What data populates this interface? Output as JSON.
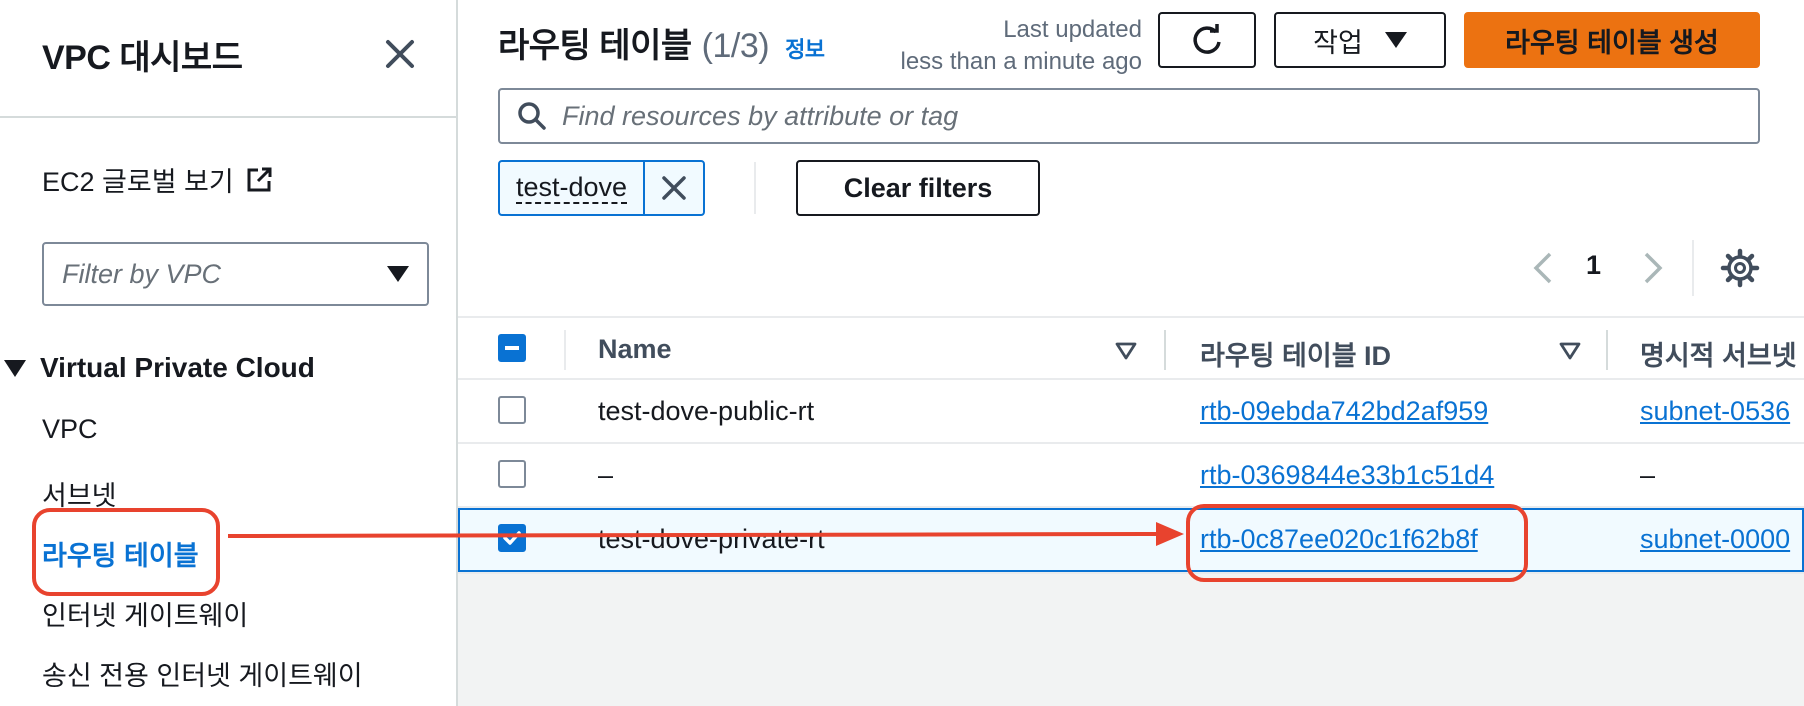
{
  "sidebar": {
    "title": "VPC 대시보드",
    "ec2_link": "EC2 글로벌 보기",
    "vpc_filter_placeholder": "Filter by VPC",
    "section_title": "Virtual Private Cloud",
    "items": [
      {
        "label": "VPC"
      },
      {
        "label": "서브넷"
      },
      {
        "label": "라우팅 테이블"
      },
      {
        "label": "인터넷 게이트웨이"
      },
      {
        "label": "송신 전용 인터넷 게이트웨이"
      }
    ]
  },
  "header": {
    "title": "라우팅 테이블",
    "count": "(1/3)",
    "info": "정보",
    "last_updated_line1": "Last updated",
    "last_updated_line2": "less than a minute ago",
    "actions_label": "작업",
    "create_label": "라우팅 테이블 생성"
  },
  "search": {
    "placeholder": "Find resources by attribute or tag"
  },
  "filter_token": "test-dove",
  "clear_filters_label": "Clear filters",
  "pagination": {
    "current_page": "1"
  },
  "table": {
    "columns": [
      "Name",
      "라우팅 테이블 ID",
      "명시적 서브넷 연"
    ],
    "rows": [
      {
        "name": "test-dove-public-rt",
        "id": "rtb-09ebda742bd2af959",
        "subnet": "subnet-0536",
        "selected": false
      },
      {
        "name": "–",
        "id": "rtb-0369844e33b1c51d4",
        "subnet": "–",
        "selected": false
      },
      {
        "name": "test-dove-private-rt",
        "id": "rtb-0c87ee020c1f62b8f",
        "subnet": "subnet-0000",
        "selected": true
      }
    ]
  },
  "colors": {
    "accent": "#0972d3",
    "primary_button": "#ec7211",
    "annotation": "#e8432e"
  }
}
